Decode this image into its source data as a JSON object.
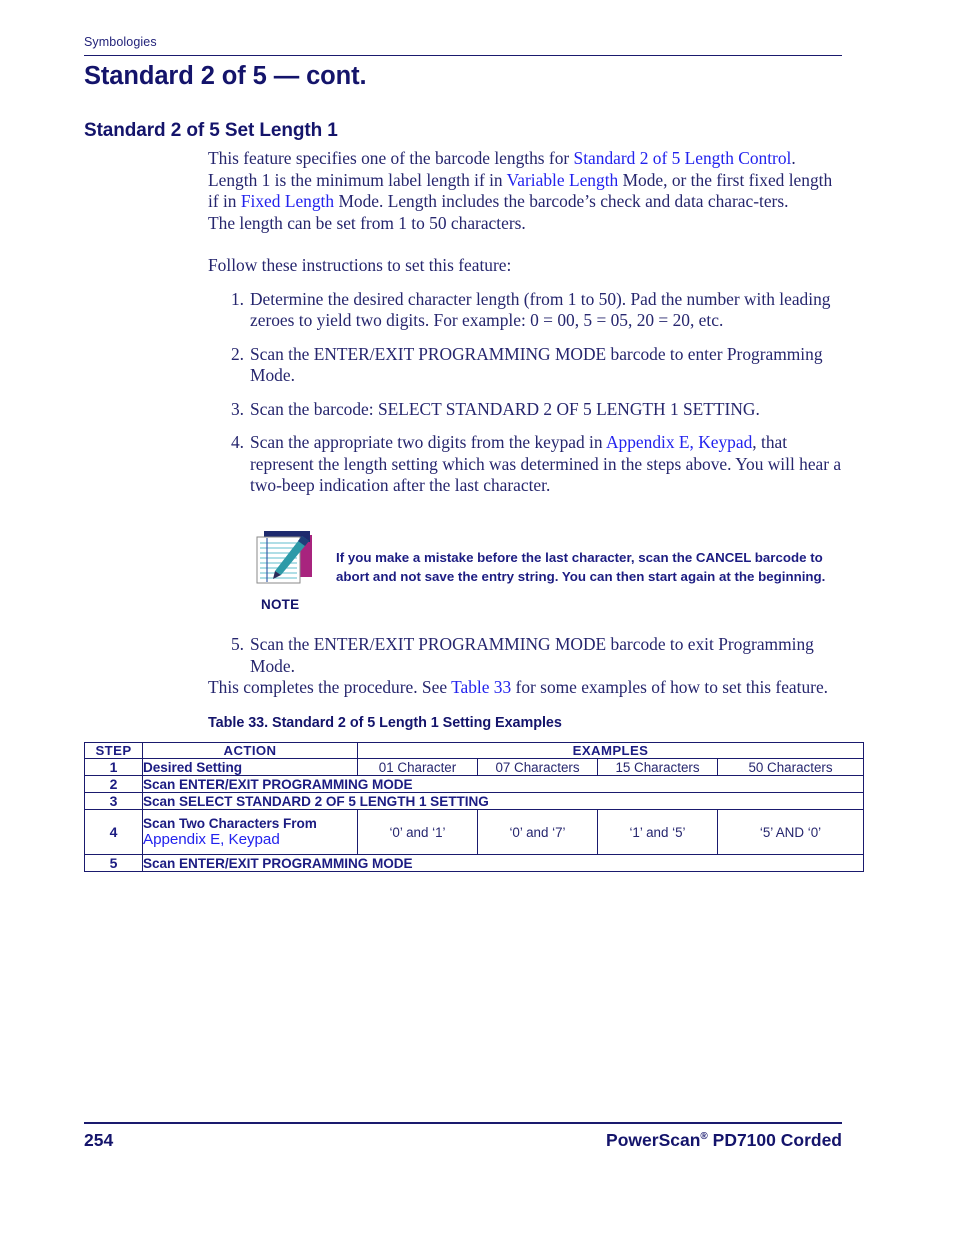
{
  "page": {
    "running_head": "Symbologies",
    "footer_page_number": "254",
    "footer_product": "PowerScan",
    "footer_product_sup": "®",
    "footer_product_rest": " PD7100 Corded"
  },
  "headings": {
    "h1": "Standard 2 of 5 — cont.",
    "h2": "Standard 2 of 5 Set Length 1"
  },
  "intro": {
    "p1_a": "This feature specifies one of the barcode lengths for ",
    "p1_link1": "Standard 2 of 5 Length Control",
    "p1_b": ". Length 1 is the minimum label length if in ",
    "p1_link2": "Variable Length",
    "p1_c": " Mode, or the first fixed length if in ",
    "p1_link3": "Fixed Length",
    "p1_d": " Mode. Length includes the barcode’s check and data charac-ters.",
    "p2": "The length can be set from 1 to 50 characters.",
    "p3": "Follow these instructions to set this feature:"
  },
  "steps": [
    {
      "num": "1.",
      "text": "Determine the desired character length (from 1 to 50). Pad the number with leading zeroes to yield two digits. For example: 0 = 00, 5 = 05, 20 = 20, etc."
    },
    {
      "num": "2.",
      "text": "Scan the ENTER/EXIT PROGRAMMING MODE barcode to enter Programming Mode."
    },
    {
      "num": "3.",
      "text": "Scan the barcode: SELECT STANDARD 2 OF 5 LENGTH 1 SETTING."
    },
    {
      "num": "4.",
      "text_a": "Scan the appropriate two digits from the keypad in ",
      "link": "Appendix E, Keypad",
      "text_b": ", that represent the length setting which was determined in the steps above. You will hear a two-beep indication after the last character."
    }
  ],
  "note": {
    "label": "NOTE",
    "icon": "notepad-pencil-icon",
    "text": "If you make a mistake before the last character, scan the CANCEL barcode to abort and not save the entry string. You can then start again at the beginning."
  },
  "step5": {
    "num": "5.",
    "text": "Scan the ENTER/EXIT PROGRAMMING MODE barcode to exit Programming Mode."
  },
  "closing": {
    "a": "This completes the procedure. See ",
    "link": "Table 33",
    "b": " for some examples of how to set this feature."
  },
  "table": {
    "caption": "Table 33. Standard 2 of 5 Length 1 Setting Examples",
    "headers": {
      "step": "STEP",
      "action": "ACTION",
      "examples": "EXAMPLES"
    },
    "rows": [
      {
        "step": "1",
        "action": "Desired Setting",
        "action_link": "",
        "examples": [
          "01 Character",
          "07 Characters",
          "15 Characters",
          "50 Characters"
        ]
      },
      {
        "step": "2",
        "action": "Scan ENTER/EXIT PROGRAMMING MODE",
        "action_link": "",
        "examples": []
      },
      {
        "step": "3",
        "action": "Scan SELECT STANDARD 2 OF 5 LENGTH 1 SETTING",
        "action_link": "",
        "examples": []
      },
      {
        "step": "4",
        "action": "Scan Two Characters From",
        "action_link": "Appendix E, Keypad",
        "examples": [
          "‘0’ and ‘1’",
          "‘0’ and ‘7’",
          "‘1’ and ‘5’",
          "‘5’ AND ‘0’"
        ]
      },
      {
        "step": "5",
        "action": "Scan ENTER/EXIT PROGRAMMING MODE",
        "action_link": "",
        "examples": []
      }
    ]
  },
  "colors": {
    "navy": "#14146b",
    "body_navy": "#26266e",
    "link_blue": "#2222ee",
    "rule": "#1a1a6e"
  }
}
